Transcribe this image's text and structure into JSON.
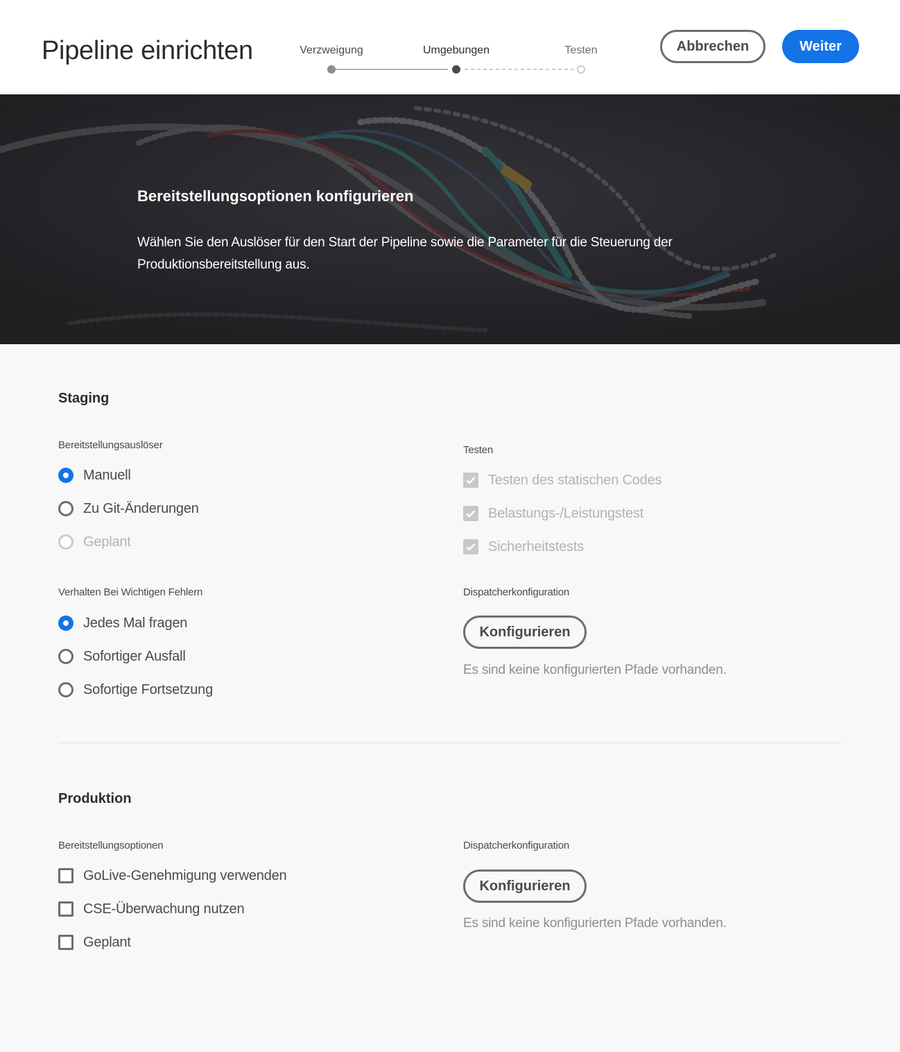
{
  "header": {
    "title": "Pipeline einrichten",
    "steps": [
      {
        "label": "Verzweigung",
        "state": "done"
      },
      {
        "label": "Umgebungen",
        "state": "current"
      },
      {
        "label": "Testen",
        "state": "future"
      }
    ],
    "cancel_label": "Abbrechen",
    "next_label": "Weiter"
  },
  "hero": {
    "title": "Bereitstellungsoptionen konfigurieren",
    "description": "Wählen Sie den Auslöser für den Start der Pipeline sowie die Parameter für die Steuerung der Produktionsbereitstellung aus."
  },
  "staging": {
    "title": "Staging",
    "trigger_label": "Bereitstellungsauslöser",
    "trigger_options": [
      {
        "label": "Manuell",
        "state": "checked"
      },
      {
        "label": "Zu Git-Änderungen",
        "state": "unchecked"
      },
      {
        "label": "Geplant",
        "state": "disabled"
      }
    ],
    "failure_label": "Verhalten Bei Wichtigen Fehlern",
    "failure_options": [
      {
        "label": "Jedes Mal fragen",
        "state": "checked"
      },
      {
        "label": "Sofortiger Ausfall",
        "state": "unchecked"
      },
      {
        "label": "Sofortige Fortsetzung",
        "state": "unchecked"
      }
    ],
    "testing_label": "Testen",
    "testing_options": [
      {
        "label": "Testen des statischen Codes",
        "state": "checked-disabled"
      },
      {
        "label": "Belastungs-/Leistungstest",
        "state": "checked-disabled"
      },
      {
        "label": "Sicherheitstests",
        "state": "checked-disabled"
      }
    ],
    "dispatcher_label": "Dispatcherkonfiguration",
    "configure_label": "Konfigurieren",
    "dispatcher_hint": "Es sind keine konfigurierten Pfade vorhanden."
  },
  "production": {
    "title": "Produktion",
    "options_label": "Bereitstellungsoptionen",
    "options": [
      {
        "label": "GoLive-Genehmigung verwenden",
        "state": "unchecked"
      },
      {
        "label": "CSE-Überwachung nutzen",
        "state": "unchecked"
      },
      {
        "label": "Geplant",
        "state": "unchecked"
      }
    ],
    "dispatcher_label": "Dispatcherkonfiguration",
    "configure_label": "Konfigurieren",
    "dispatcher_hint": "Es sind keine konfigurierten Pfade vorhanden."
  },
  "colors": {
    "accent": "#1473e6",
    "hero_bg": "#2a2a2d",
    "page_bg": "#f8f8f8"
  }
}
